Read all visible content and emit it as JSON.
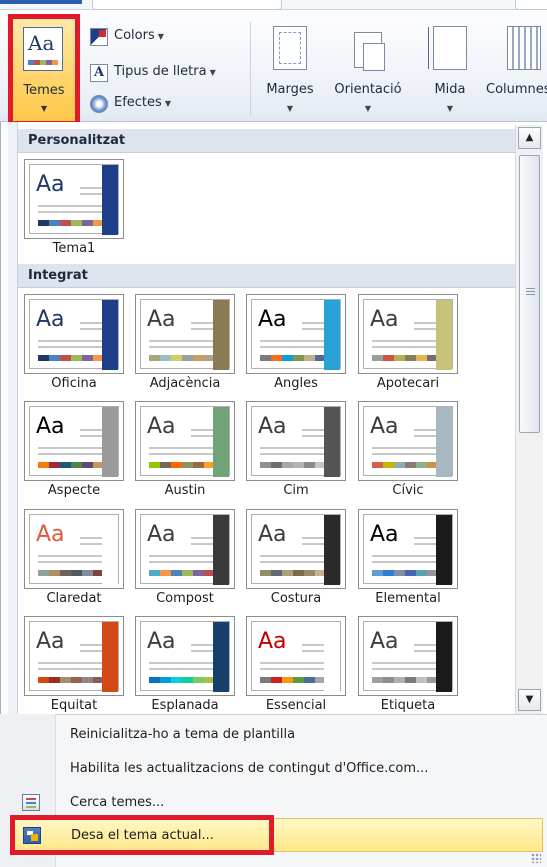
{
  "ribbon": {
    "temes_label": "Temes",
    "colors_label": "Colors",
    "fonts_label": "Tipus de lletra",
    "effects_label": "Efectes",
    "font_icon_glyph": "A",
    "margins_label": "Marges",
    "orientation_label": "Orientació",
    "size_label": "Mida",
    "columns_label": "Columnes"
  },
  "gallery": {
    "custom_header": "Personalitzat",
    "builtin_header": "Integrat",
    "custom_themes": [
      {
        "name": "Tema1",
        "aa": "Aa",
        "aa_color": "#1f3864",
        "stripe": "#1f3e88",
        "swatch": [
          "#1f3864",
          "#4f81bd",
          "#c0504d",
          "#9bbb59",
          "#8064a2",
          "#f79646"
        ]
      }
    ],
    "builtin_themes": [
      {
        "name": "Oficina",
        "aa": "Aa",
        "aa_color": "#1f3864",
        "stripe": "#1f3e88",
        "swatch": [
          "#1f3864",
          "#4f81bd",
          "#c0504d",
          "#9bbb59",
          "#8064a2",
          "#f79646"
        ]
      },
      {
        "name": "Adjacència",
        "aa": "Aa",
        "aa_color": "#3d3d3d",
        "stripe": "#8a7a55",
        "swatch": [
          "#a9a57c",
          "#9cbebd",
          "#d2cb6c",
          "#95a39d",
          "#c89f5d",
          "#b1a089"
        ]
      },
      {
        "name": "Angles",
        "aa": "Aa",
        "aa_color": "#000000",
        "stripe": "#27a1d8",
        "swatch": [
          "#797b7e",
          "#f96a1b",
          "#08a1d9",
          "#7c984a",
          "#c2ad8d",
          "#506e94"
        ]
      },
      {
        "name": "Apotecari",
        "aa": "Aa",
        "aa_color": "#3d3d3d",
        "stripe": "#c7c27a",
        "swatch": [
          "#93a299",
          "#cf543f",
          "#b5ae53",
          "#848058",
          "#e8b54d",
          "#786c71"
        ]
      },
      {
        "name": "Aspecte",
        "aa": "Aa",
        "aa_color": "#000000",
        "stripe": "#9a9a9a",
        "swatch": [
          "#f07f09",
          "#9f2936",
          "#1b587c",
          "#4e8542",
          "#604878",
          "#c19859"
        ]
      },
      {
        "name": "Austin",
        "aa": "Aa",
        "aa_color": "#3d3d3d",
        "stripe": "#72a376",
        "swatch": [
          "#94c600",
          "#71685a",
          "#ff6700",
          "#909465",
          "#956b43",
          "#fea022"
        ]
      },
      {
        "name": "Cim",
        "aa": "Aa",
        "aa_color": "#3d3d3d",
        "stripe": "#555555",
        "swatch": [
          "#909090",
          "#6e6e6e",
          "#a8a8a8",
          "#b4b4b4",
          "#8a8a8a",
          "#c6c6c6"
        ]
      },
      {
        "name": "Cívic",
        "aa": "Aa",
        "aa_color": "#3d3d3d",
        "stripe": "#a8b8c0",
        "swatch": [
          "#d16349",
          "#ccb400",
          "#8cadae",
          "#8c7b70",
          "#8fb08c",
          "#d19049"
        ]
      },
      {
        "name": "Claredat",
        "aa": "Aa",
        "aa_color": "#e0583c",
        "stripe": "#ffffff",
        "swatch": [
          "#93a299",
          "#ad8f67",
          "#726056",
          "#4c5a6a",
          "#808da0",
          "#79463d"
        ]
      },
      {
        "name": "Compost",
        "aa": "Aa",
        "aa_color": "#3d3d3d",
        "stripe": "#3a3a3a",
        "swatch": [
          "#4bacc6",
          "#f79646",
          "#4f81bd",
          "#9bbb59",
          "#8064a2",
          "#c0504d"
        ]
      },
      {
        "name": "Costura",
        "aa": "Aa",
        "aa_color": "#3d3d3d",
        "stripe": "#2b2b2b",
        "swatch": [
          "#938f61",
          "#5f6b6d",
          "#a5a27d",
          "#7b6a4d",
          "#9a8a6a",
          "#c6b68e"
        ]
      },
      {
        "name": "Elemental",
        "aa": "Aa",
        "aa_color": "#000000",
        "stripe": "#1b1b1b",
        "swatch": [
          "#629dd1",
          "#297fd5",
          "#7f8fa9",
          "#4a66ac",
          "#5aa2ae",
          "#9d90a0"
        ]
      },
      {
        "name": "Equitat",
        "aa": "Aa",
        "aa_color": "#3d3d3d",
        "stripe": "#d34817",
        "swatch": [
          "#d34817",
          "#9b2d1f",
          "#a28e6a",
          "#956251",
          "#918485",
          "#855d5d"
        ]
      },
      {
        "name": "Esplanada",
        "aa": "Aa",
        "aa_color": "#3d3d3d",
        "stripe": "#17406d",
        "swatch": [
          "#0f6fc6",
          "#009dd9",
          "#0bd0d9",
          "#10cf9b",
          "#7cca62",
          "#a5c249"
        ]
      },
      {
        "name": "Essencial",
        "aa": "Aa",
        "aa_color": "#c00000",
        "stripe": "#ffffff",
        "swatch": [
          "#7a7a7a",
          "#d0201b",
          "#f89813",
          "#5f9842",
          "#4a6f9a",
          "#a8a8a8"
        ]
      },
      {
        "name": "Etiqueta",
        "aa": "Aa",
        "aa_color": "#3d3d3d",
        "stripe": "#1a1a1a",
        "swatch": [
          "#a0a0a0",
          "#8e8e8e",
          "#b0b0b0",
          "#7a7a7a",
          "#c0c0c0",
          "#9a9a9a"
        ]
      }
    ]
  },
  "menu": {
    "reset": "Reinicialitza-ho a tema de plantilla",
    "enable_updates": "Habilita les actualitzacions de contingut d'Office.com...",
    "browse": "Cerca temes...",
    "save": "Desa el tema actual..."
  },
  "icons": {
    "scroll_up": "▲",
    "scroll_down": "▼",
    "dropdown": "▼"
  }
}
